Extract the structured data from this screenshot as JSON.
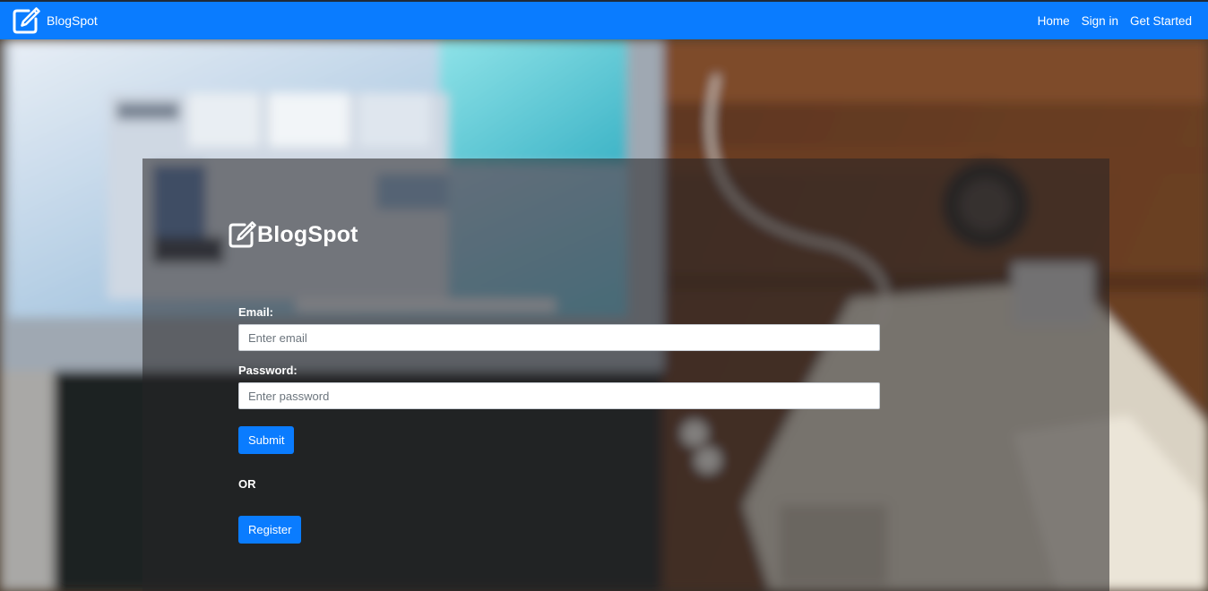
{
  "navbar": {
    "brand": "BlogSpot",
    "brand_icon": "edit-square-icon",
    "links": [
      {
        "label": "Home"
      },
      {
        "label": "Sign in"
      },
      {
        "label": "Get Started"
      }
    ],
    "background_color": "#0a7cff"
  },
  "card": {
    "brand": "BlogSpot",
    "brand_icon": "edit-square-icon"
  },
  "form": {
    "email_label": "Email:",
    "email_placeholder": "Enter email",
    "email_value": "",
    "password_label": "Password:",
    "password_placeholder": "Enter password",
    "password_value": "",
    "submit_label": "Submit",
    "or_text": "OR",
    "register_label": "Register"
  },
  "colors": {
    "accent": "#0a7cff",
    "text_light": "#ffffff"
  }
}
